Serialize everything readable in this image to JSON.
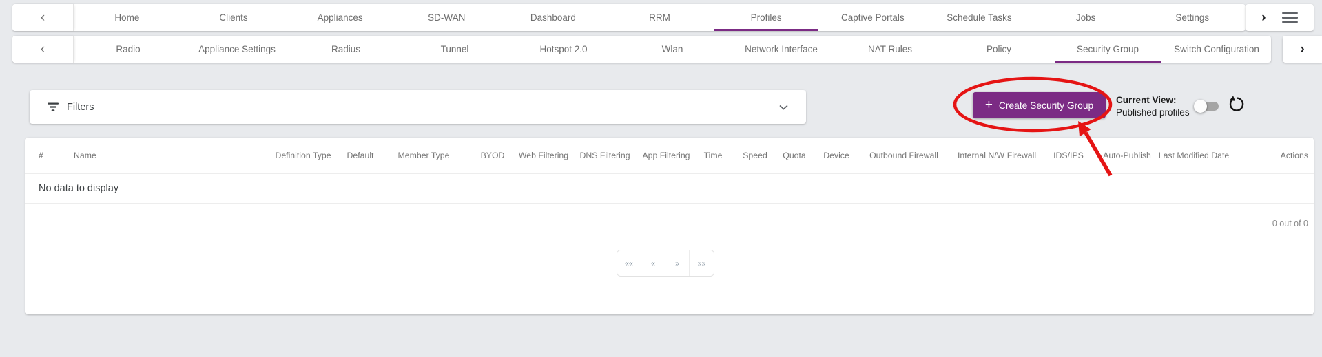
{
  "nav": {
    "tabs": [
      "Home",
      "Clients",
      "Appliances",
      "SD-WAN",
      "Dashboard",
      "RRM",
      "Profiles",
      "Captive Portals",
      "Schedule Tasks",
      "Jobs",
      "Settings"
    ],
    "active_tab": "Profiles"
  },
  "subnav": {
    "tabs": [
      "Radio",
      "Appliance Settings",
      "Radius",
      "Tunnel",
      "Hotspot 2.0",
      "Wlan",
      "Network Interface",
      "NAT Rules",
      "Policy",
      "Security Group",
      "Switch Configuration"
    ],
    "active_tab": "Security Group"
  },
  "icons": {
    "chevron_left": "‹",
    "chevron_right": "›",
    "plus": "+"
  },
  "filters": {
    "label": "Filters"
  },
  "toolbar": {
    "create_button_label": "Create Security Group",
    "current_view_label": "Current View:",
    "current_view_value": "Published profiles",
    "published_toggle_on": false
  },
  "table": {
    "columns": [
      "#",
      "Name",
      "Definition Type",
      "Default",
      "Member Type",
      "BYOD",
      "Web Filtering",
      "DNS Filtering",
      "App Filtering",
      "Time",
      "Speed",
      "Quota",
      "Device",
      "Outbound Firewall",
      "Internal N/W Firewall",
      "IDS/IPS",
      "Auto-Publish",
      "Last Modified Date",
      "Actions"
    ],
    "empty_message": "No data to display",
    "count_label": "0 out of 0"
  },
  "pagination": {
    "first": "««",
    "prev": "«",
    "next": "»",
    "last": "»»"
  },
  "colors": {
    "accent_purple": "#7b2b84",
    "annotation_red": "#e51414",
    "background_gray": "#e8eaed"
  }
}
